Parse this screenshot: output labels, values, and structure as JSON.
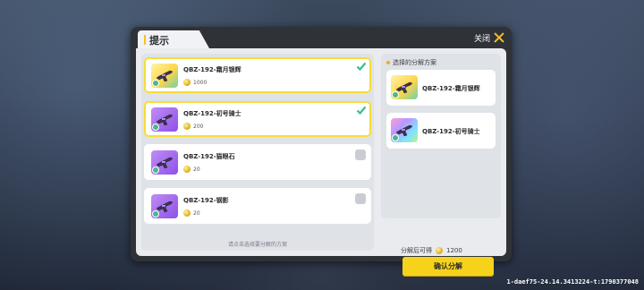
{
  "dialog": {
    "title": "提示",
    "close_label": "关闭"
  },
  "items": [
    {
      "name": "QBZ-192-霜月银辉",
      "price": "1000",
      "selected": true,
      "thumb": "yellow"
    },
    {
      "name": "QBZ-192-初号骑士",
      "price": "200",
      "selected": true,
      "thumb": "purple"
    },
    {
      "name": "QBZ-192-猫眼石",
      "price": "20",
      "selected": false,
      "thumb": "purple"
    },
    {
      "name": "QBZ-192-钢影",
      "price": "20",
      "selected": false,
      "thumb": "purple"
    }
  ],
  "hint": "请点击选择要分解的方案",
  "right_panel": {
    "title": "选择的分解方案",
    "plans": [
      {
        "name": "QBZ-192-霜月银辉",
        "thumb": "yellow"
      },
      {
        "name": "QBZ-192-初号骑士",
        "thumb": "rainbow"
      }
    ]
  },
  "result": {
    "label": "分解后可得",
    "value": "1200"
  },
  "confirm_label": "确认分解",
  "build_id": "1-daef75-24.14.3413224-t:1790377048",
  "colors": {
    "accent": "#f7d21b",
    "selected_border": "#f7dd3a",
    "check": "#3dbb8a"
  },
  "icons": [
    "close-icon",
    "coin-icon",
    "check-icon",
    "gun-icon"
  ]
}
